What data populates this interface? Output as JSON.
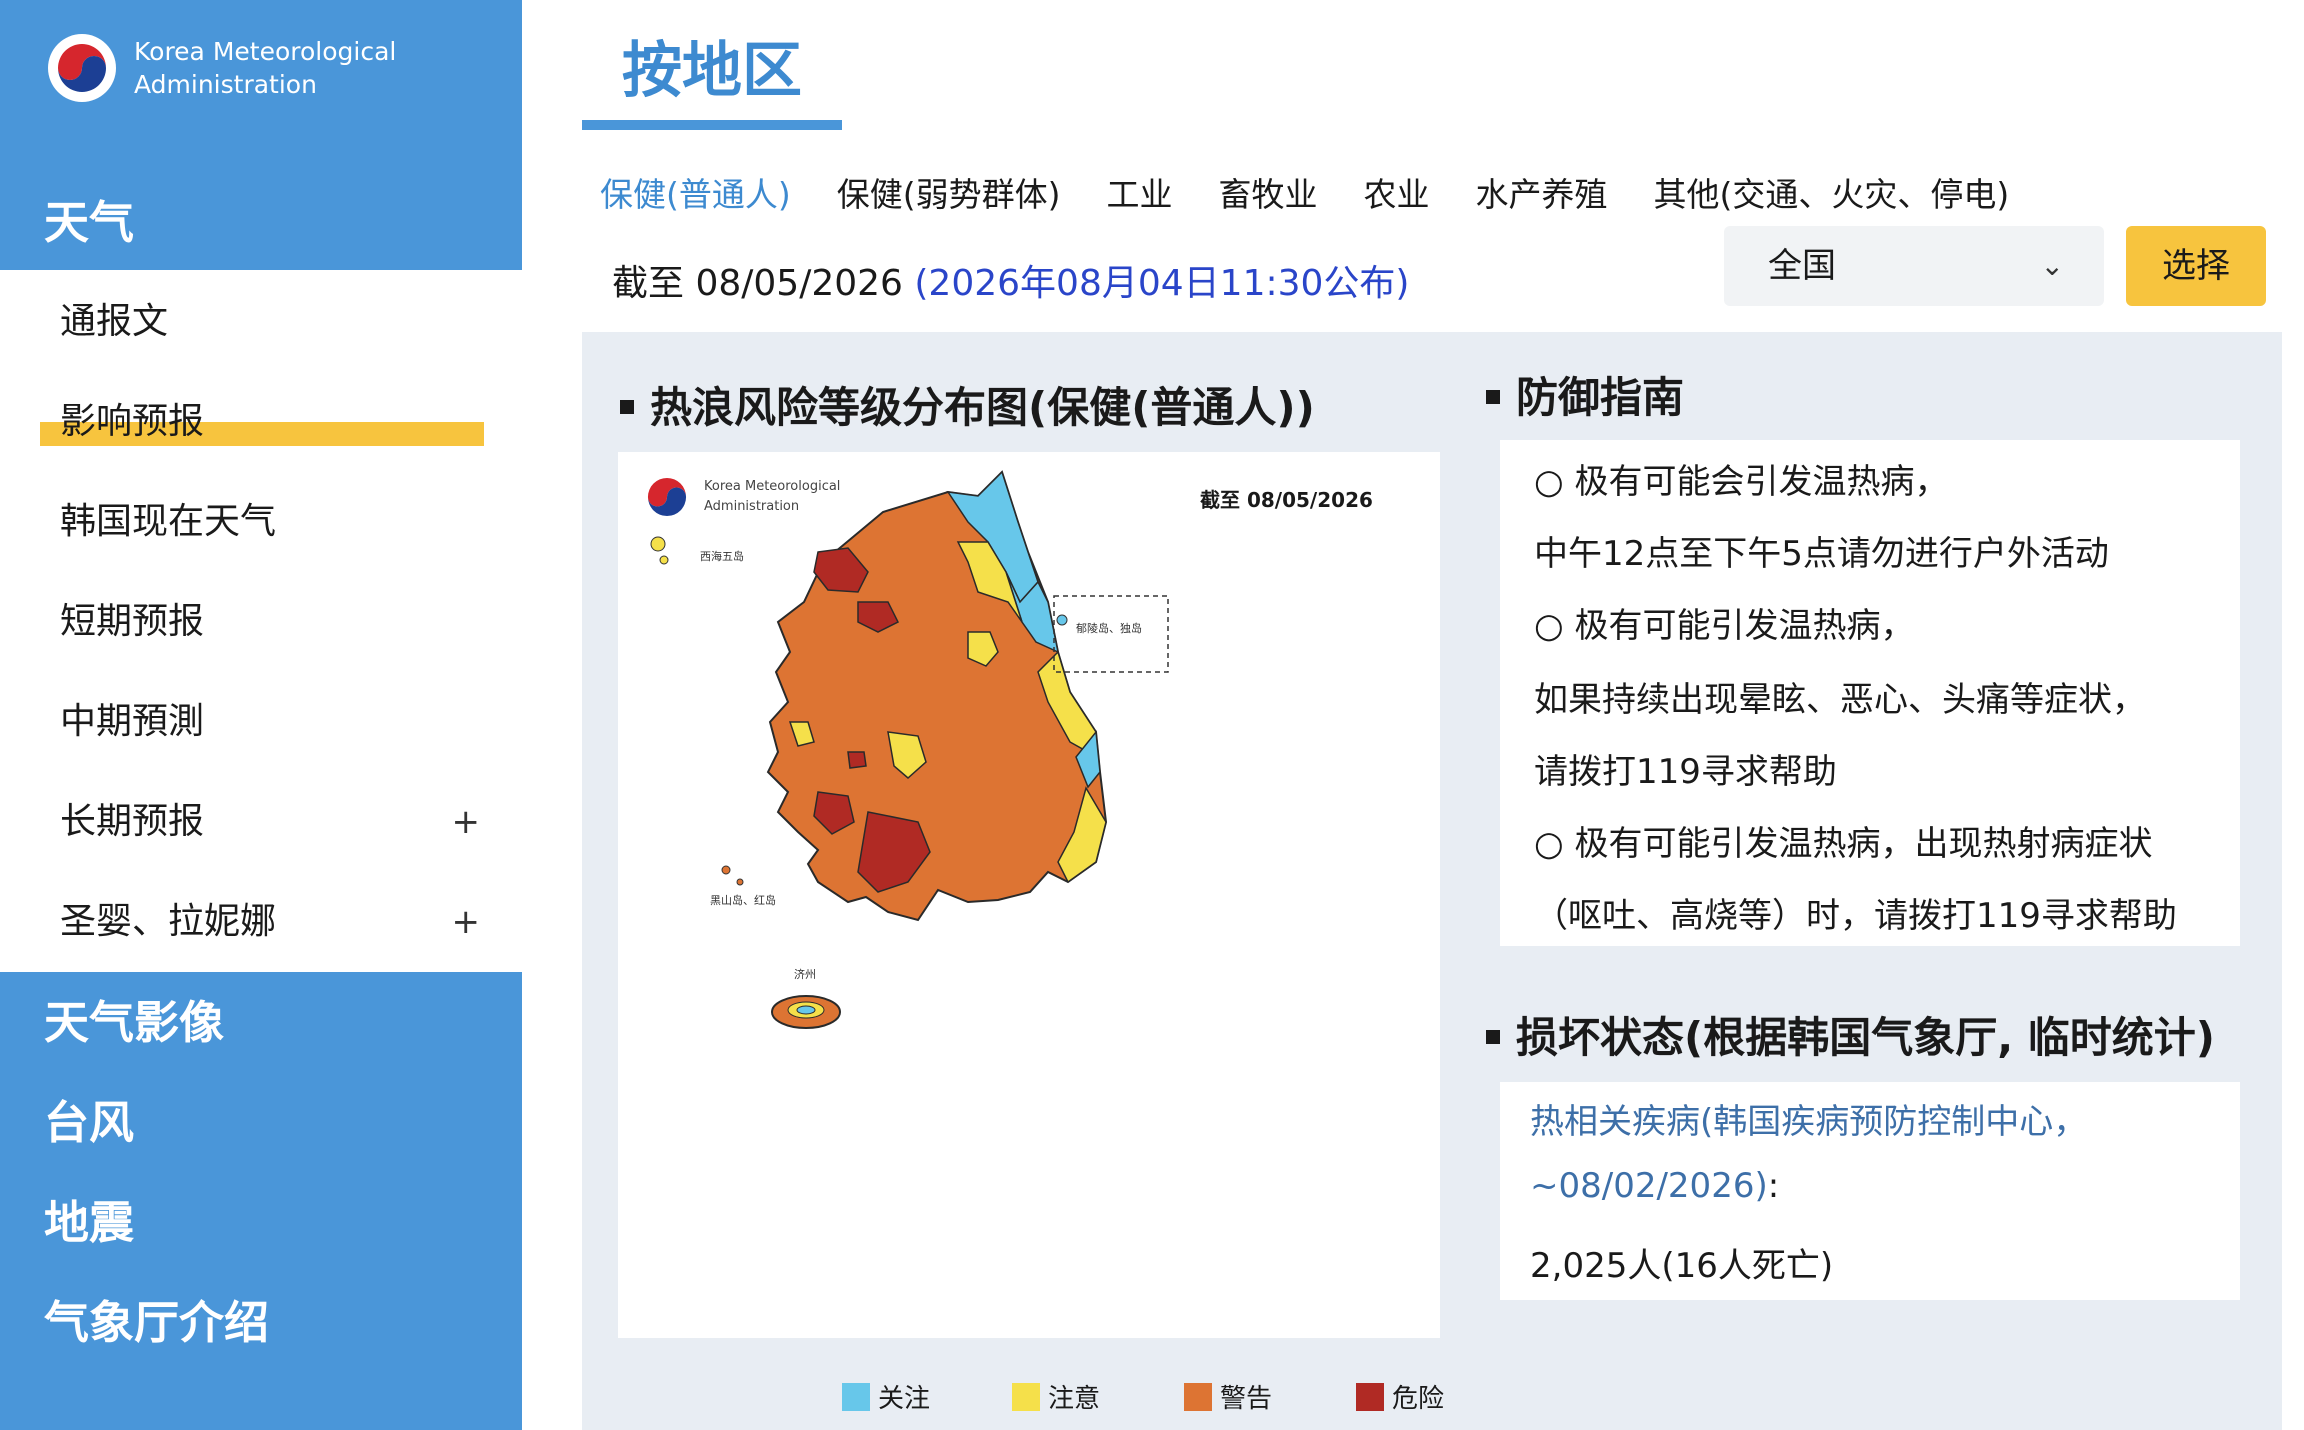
{
  "brand": {
    "org_line1": "Korea Meteorological",
    "org_line2": "Administration"
  },
  "sidebar": {
    "category_weather": "天气",
    "items": [
      {
        "label": "通报文"
      },
      {
        "label": "影响预报"
      },
      {
        "label": "韩国现在天气"
      },
      {
        "label": "短期预报"
      },
      {
        "label": "中期預測"
      },
      {
        "label": "长期预报",
        "expand": "+"
      },
      {
        "label": "圣婴、拉妮娜",
        "expand": "+"
      }
    ],
    "categories": [
      "天气影像",
      "台风",
      "地震",
      "气象厅介绍"
    ]
  },
  "page": {
    "title": "按地区"
  },
  "tabs": [
    "保健(普通人)",
    "保健(弱势群体)",
    "工业",
    "畜牧业",
    "农业",
    "水产养殖",
    "其他(交通、火灾、停电)"
  ],
  "date_info": {
    "as_of": "截至 08/05/2026",
    "published": "(2026年08月04日11:30公布)"
  },
  "region_select": {
    "value": "全国"
  },
  "select_button": "选择",
  "map_section": {
    "heading": "热浪风险等级分布图(保健(普通人))",
    "map_org_line1": "Korea Meteorological",
    "map_org_line2": "Administration",
    "map_date": "截至 08/05/2026",
    "labels": {
      "seohae": "西海五岛",
      "ulleung": "郁陵岛、独岛",
      "heuksan": "黑山岛、红岛",
      "jeju": "济州"
    }
  },
  "legend": [
    {
      "label": "关注",
      "color": "#67c7ea"
    },
    {
      "label": "注意",
      "color": "#f5e04a"
    },
    {
      "label": "警告",
      "color": "#dd7433"
    },
    {
      "label": "危险",
      "color": "#b02a24"
    }
  ],
  "guide": {
    "heading": "防御指南",
    "lines": [
      "○ 极有可能会引发温热病，",
      "中午12点至下午5点请勿进行户外活动",
      "○ 极有可能引发温热病，",
      "如果持续出现晕眩、恶心、头痛等症状，",
      "请拨打119寻求帮助",
      "○ 极有可能引发温热病，出现热射病症状",
      "（呕吐、高烧等）时，请拨打119寻求帮助"
    ]
  },
  "damage": {
    "heading": "损坏状态(根据韩国气象厅, 临时统计)",
    "link_line1": "热相关疾病(韩国疾病预防控制中心，",
    "link_line2": "~08/02/2026)",
    "colon": ":",
    "value": "2,025人(16人死亡)"
  }
}
